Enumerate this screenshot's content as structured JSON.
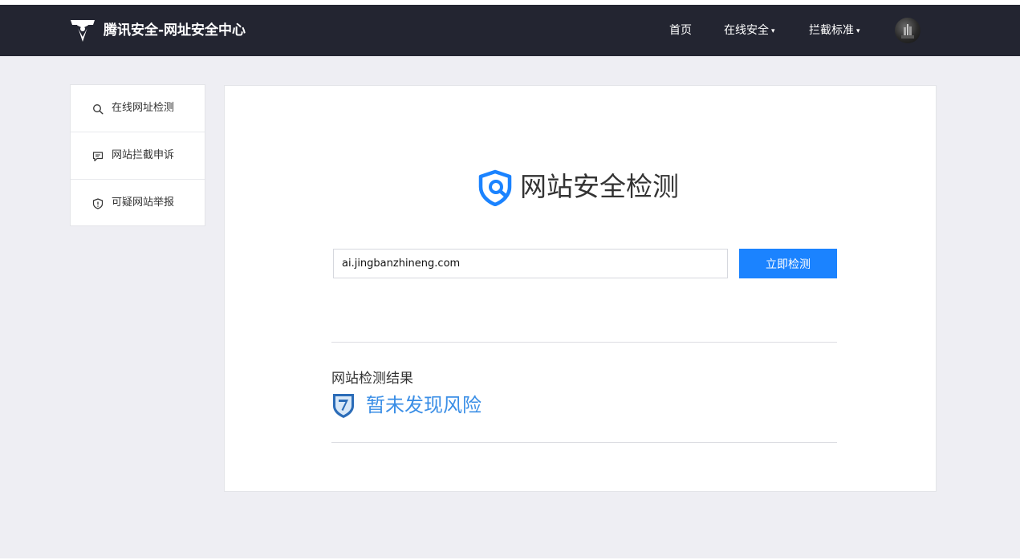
{
  "header": {
    "brand": "腾讯安全-网址安全中心",
    "nav": [
      {
        "label": "首页",
        "has_dropdown": false
      },
      {
        "label": "在线安全",
        "has_dropdown": true
      },
      {
        "label": "拦截标准",
        "has_dropdown": true
      }
    ],
    "caret": "▾"
  },
  "sidebar": {
    "items": [
      {
        "label": "在线网址检测",
        "icon": "search-icon"
      },
      {
        "label": "网站拦截申诉",
        "icon": "comment-icon"
      },
      {
        "label": "可疑网站举报",
        "icon": "shield-alert-icon"
      }
    ]
  },
  "main": {
    "title": "网站安全检测",
    "url_value": "ai.jingbanzhineng.com",
    "check_button": "立即检测",
    "result_label": "网站检测结果",
    "result_value": "暂未发现风险"
  },
  "colors": {
    "header_bg": "#232531",
    "accent": "#1b83ff",
    "result_text": "#3a8ee6",
    "page_bg": "#eeeef3"
  }
}
